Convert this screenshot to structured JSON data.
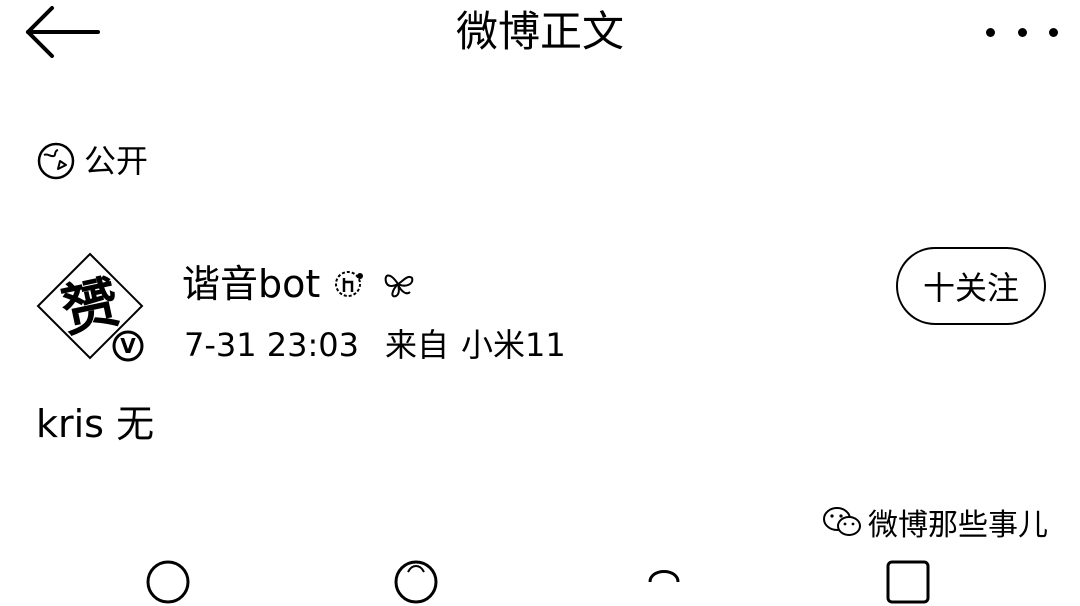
{
  "header": {
    "title": "微博正文",
    "back_icon": "arrow-left-icon",
    "more_icon": "more-dots-icon"
  },
  "visibility": {
    "icon": "globe-icon",
    "label": "公开"
  },
  "author": {
    "name": "谐音bot",
    "avatar_text": "赟",
    "verified_badge": "V",
    "time": "7-31 23:03",
    "source_prefix": "来自",
    "source_device": "小米11"
  },
  "follow": {
    "label": "十关注"
  },
  "post": {
    "text": "kris 无"
  },
  "watermark": {
    "text": "微博那些事儿",
    "icon": "wechat-icon"
  },
  "actions": [
    {
      "icon": "share-icon"
    },
    {
      "icon": "comment-icon"
    },
    {
      "icon": "like-icon"
    },
    {
      "icon": "collect-icon"
    }
  ]
}
